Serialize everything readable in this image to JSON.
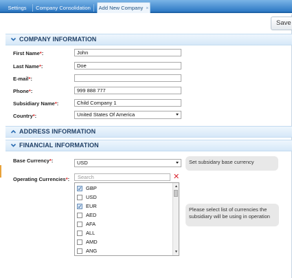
{
  "tabs": [
    {
      "label": "Settings",
      "active": false
    },
    {
      "label": "Company Consolidation",
      "active": false
    },
    {
      "label": "Add New Company",
      "active": true,
      "close_glyph": "×"
    }
  ],
  "toolbar": {
    "save_label": "Save a"
  },
  "sections": {
    "company": {
      "title": "COMPANY INFORMATION",
      "state": "expanded"
    },
    "address": {
      "title": "ADDRESS INFORMATION",
      "state": "collapsed"
    },
    "financial": {
      "title": "FINANCIAL INFORMATION",
      "state": "expanded"
    }
  },
  "company": {
    "first_name": {
      "label": "First Name",
      "required": "*",
      "suffix": ":",
      "value": "John"
    },
    "last_name": {
      "label": "Last Name",
      "required": "*",
      "suffix": ":",
      "value": "Doe"
    },
    "email": {
      "label": "E-mail",
      "required": "*",
      "suffix": ":",
      "value": ""
    },
    "phone": {
      "label": "Phone",
      "required": "*",
      "suffix": ":",
      "value": "999 888 777"
    },
    "subsidiary": {
      "label": "Subsidiary Name",
      "required": "*",
      "suffix": ":",
      "value": "Child Company 1"
    },
    "country": {
      "label": "Country",
      "required": "*",
      "suffix": ":",
      "value": "United States Of America"
    }
  },
  "financial": {
    "base_currency": {
      "label": "Base Currency",
      "required": "*",
      "suffix": ":",
      "value": "USD",
      "hint": "Set subsidary base currency"
    },
    "operating": {
      "label": "Operating Currencies",
      "required": "*",
      "suffix": ":",
      "search_placeholder": "Search",
      "clear_glyph": "✕",
      "hint": "Please select list of currencies the subsidiary will be using in operation",
      "items": [
        {
          "code": "GBP",
          "checked": true
        },
        {
          "code": "USD",
          "checked": false
        },
        {
          "code": "EUR",
          "checked": true
        },
        {
          "code": "AED",
          "checked": false
        },
        {
          "code": "AFA",
          "checked": false
        },
        {
          "code": "ALL",
          "checked": false
        },
        {
          "code": "AMD",
          "checked": false
        },
        {
          "code": "ANG",
          "checked": false
        }
      ]
    }
  },
  "colors": {
    "required": "#dd2222",
    "header_text": "#1f3f66",
    "tab_bar": "#2d78c4"
  }
}
